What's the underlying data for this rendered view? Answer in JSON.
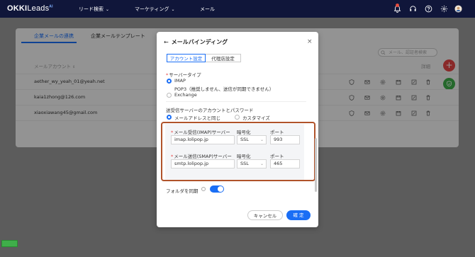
{
  "nav": {
    "logo_main": "OKKI",
    "logo_sub": "Leads",
    "logo_sup": "AI",
    "items": [
      {
        "label": "リード検索",
        "chevron": "⌄"
      },
      {
        "label": "マーケティング",
        "chevron": "⌄"
      },
      {
        "label": "メール",
        "chevron": ""
      }
    ]
  },
  "background": {
    "tabs": [
      "企業メールの連携",
      "企業メールテンプレート"
    ],
    "search_placeholder": "メール、認証者検索",
    "col_account": "メールアカウント",
    "col_details": "詳細",
    "rows": [
      {
        "email": "aether_wy_yeah_01@yeah.net"
      },
      {
        "email": "kaia1zhong@126.com"
      },
      {
        "email": "xiaoxiawang45@gmail.com"
      }
    ]
  },
  "modal": {
    "back_arrow": "←",
    "title": "メールバインディング",
    "close": "×",
    "tabs": [
      "アカウント設定",
      "代理店設定"
    ],
    "server_type_label": "サーバータイプ",
    "server_types": [
      "IMAP",
      "POP3（推奨しません、送信が同期できません）",
      "Exchange"
    ],
    "credentials_label": "送受信サーバーのアカウントとパスワード",
    "credential_options": [
      "メールアドレスと同じ",
      "カスタマイズ"
    ],
    "imap": {
      "server_label": "メール受信(IMAP)サーバー",
      "encrypt_label": "暗号化",
      "port_label": "ポート",
      "server_value": "imap.lolipop.jp",
      "encrypt_value": "SSL",
      "port_value": "993"
    },
    "smtp": {
      "server_label": "メール送信(SMAP)サーバー",
      "encrypt_label": "暗号化",
      "port_label": "ポート",
      "server_value": "smtp.lolipop.jp",
      "encrypt_value": "SSL",
      "port_value": "465"
    },
    "folder_sync_label": "フォルダを同期",
    "folder_sync_on": true,
    "cancel_label": "キャンセル",
    "confirm_label": "確 定"
  },
  "colors": {
    "nav_bg": "#10163a",
    "accent": "#1a6ef5",
    "highlight": "#b0532a",
    "fab_red": "#e54545",
    "fab_green": "#3fae4a"
  }
}
